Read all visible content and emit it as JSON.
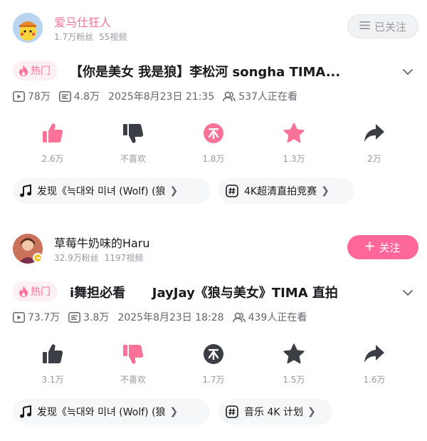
{
  "colors": {
    "pink": "#fb7299",
    "follow_bg": "#ff6699",
    "gray": "#9499a0",
    "icon_dark": "#3b3f45"
  },
  "posts": [
    {
      "author": {
        "name": "爱马仕狂人",
        "fans": "1.7万粉丝",
        "videos": "55视频"
      },
      "follow_label": "已关注",
      "hot_label": "热门",
      "title": "【你是美女 我是狼】李松河 songha TIMA...",
      "meta": {
        "plays": "78万",
        "danmaku": "4.8万",
        "date": "2025年8月23日 21:35",
        "watching": "537人正在看"
      },
      "actions": {
        "like": "2.6万",
        "dislike": "不喜欢",
        "coin": "1.8万",
        "favorite": "1.3万",
        "share": "2万"
      },
      "chips": [
        {
          "label": "发现《늑대와 미녀 (Wolf) (狼"
        },
        {
          "label": "4K超清直拍竞赛"
        }
      ]
    },
    {
      "author": {
        "name": "草莓牛奶味的Haru",
        "fans": "32.9万粉丝",
        "videos": "1197视频"
      },
      "follow_label": "关注",
      "hot_label": "热门",
      "title": "i舞担必看      JayJay《狼与美女》TIMA 直拍",
      "meta": {
        "plays": "73.7万",
        "danmaku": "3.8万",
        "date": "2025年8月23日 18:28",
        "watching": "439人正在看"
      },
      "actions": {
        "like": "3.1万",
        "dislike": "不喜欢",
        "coin": "1.7万",
        "favorite": "1.5万",
        "share": "1.6万"
      },
      "chips": [
        {
          "label": "发现《늑대와 미녀 (Wolf) (狼"
        },
        {
          "label": "音乐 4K 计划"
        }
      ]
    }
  ]
}
